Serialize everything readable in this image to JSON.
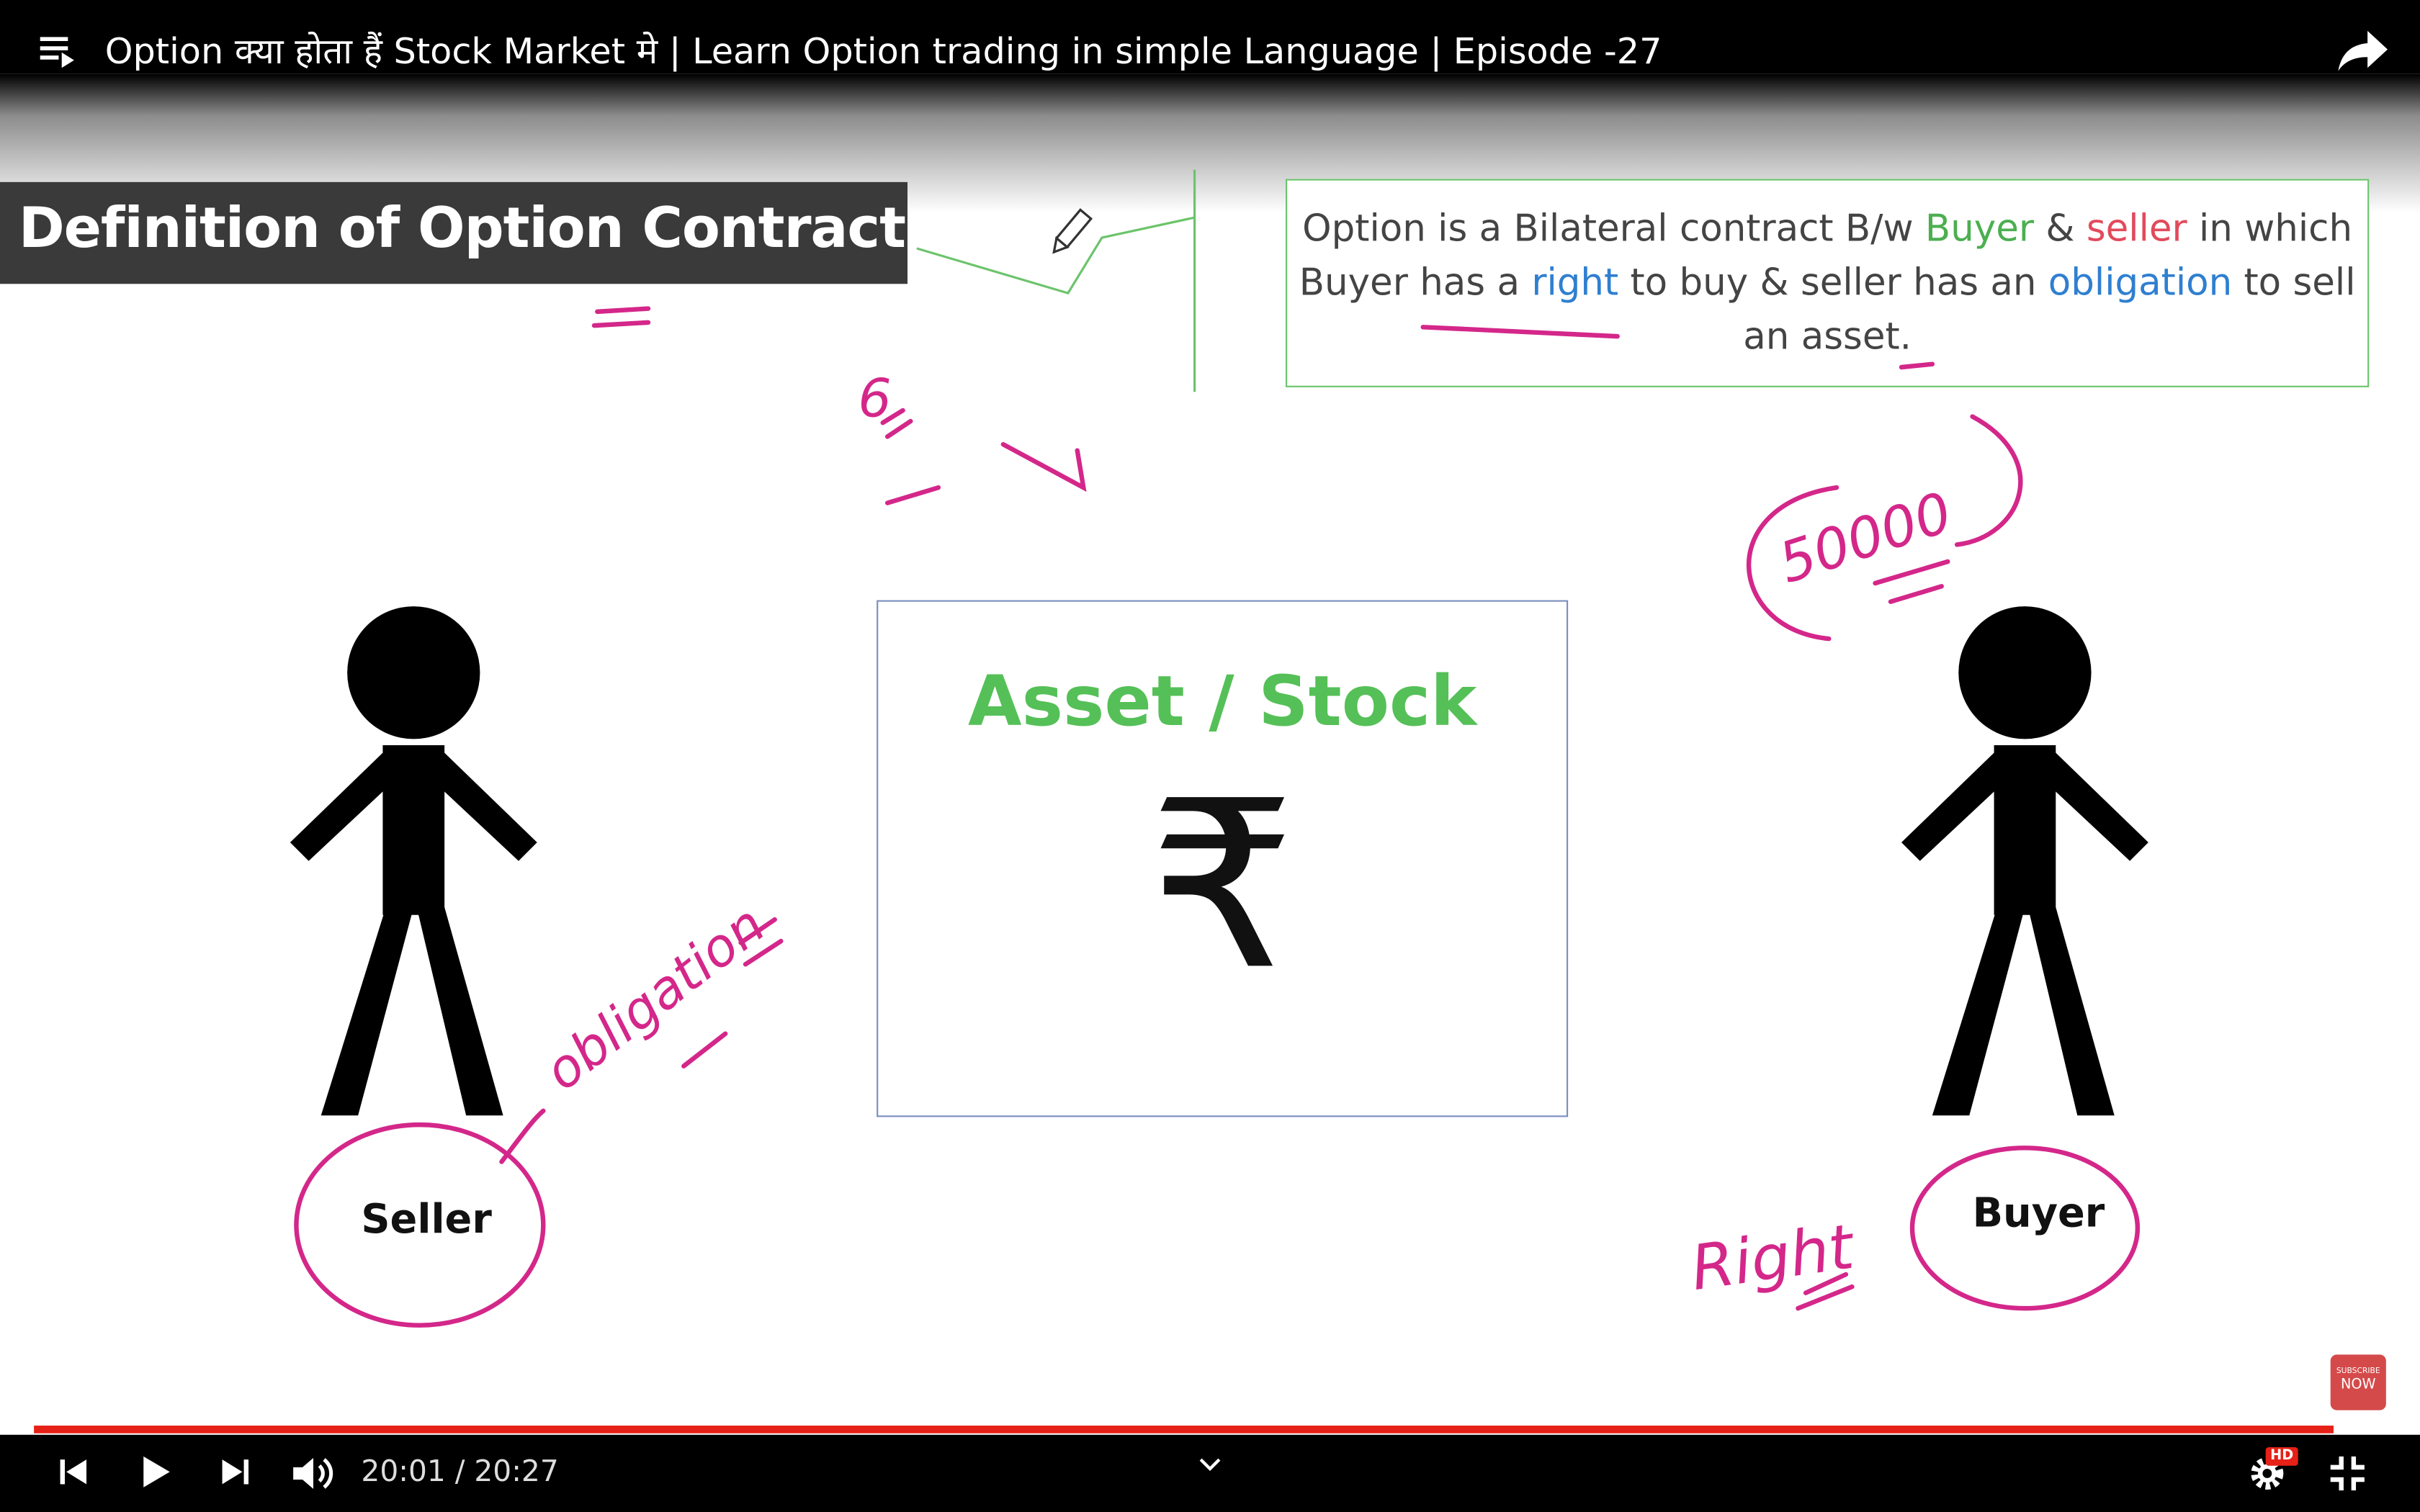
{
  "header": {
    "title": "Option क्या होता हैं Stock Market मे | Learn Option trading in simple Language | Episode -27",
    "icons": {
      "playlist": "playlist-icon",
      "share": "share-icon"
    }
  },
  "slide": {
    "heading": "Definition of Option Contract",
    "definition": {
      "w1": "Option",
      "w2": " is a Bilateral contract B/w ",
      "w3": "Buyer",
      "w4": " & ",
      "w5": "seller",
      "w6": " in which Buyer has a ",
      "w7": "right",
      "w8": " to buy & seller has an ",
      "w9": "obligation",
      "w10": " to sell an asset."
    },
    "asset_title": "Asset / Stock",
    "currency_symbol": "₹",
    "seller_label": "Seller",
    "buyer_label": "Buyer",
    "colors": {
      "accent_green": "#4caf50",
      "accent_red": "#e24a5c",
      "accent_blue": "#2f7fd0",
      "ink": "#d4278a"
    }
  },
  "handwriting": {
    "obligation": "obligation",
    "right": "Right",
    "amount": "50000",
    "six": "6"
  },
  "subscribe": {
    "line1": "SUBSCRIBE",
    "line2": "NOW"
  },
  "player": {
    "current_time": "20:01",
    "separator": " / ",
    "duration": "20:27",
    "progress_fraction": 0.978,
    "hd_badge": "HD",
    "icons": {
      "prev": "previous-icon",
      "play": "play-icon",
      "next": "next-icon",
      "volume": "volume-icon",
      "chevron": "chevron-down-icon",
      "settings": "gear-icon",
      "fullscreen": "exit-fullscreen-icon"
    }
  }
}
